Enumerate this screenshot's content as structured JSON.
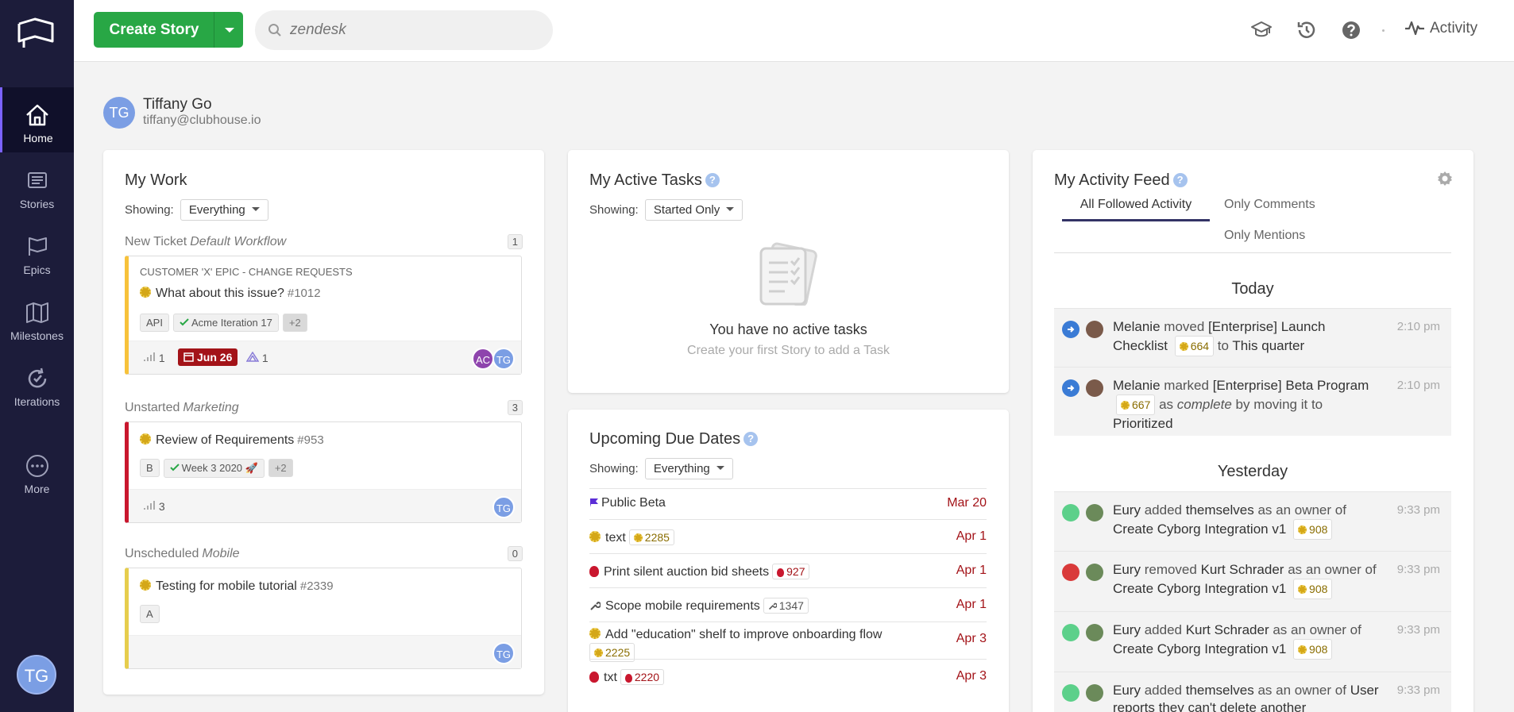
{
  "sidebar": {
    "items": [
      {
        "label": "Home"
      },
      {
        "label": "Stories"
      },
      {
        "label": "Epics"
      },
      {
        "label": "Milestones"
      },
      {
        "label": "Iterations"
      },
      {
        "label": "More"
      }
    ],
    "avatar_initials": "TG"
  },
  "topbar": {
    "create_label": "Create Story",
    "search_placeholder": "zendesk",
    "activity_label": "Activity"
  },
  "user": {
    "initials": "TG",
    "name": "Tiffany Go",
    "email": "tiffany@clubhouse.io"
  },
  "my_work": {
    "title": "My Work",
    "showing_label": "Showing:",
    "filter": "Everything",
    "groups": [
      {
        "state": "New Ticket",
        "workflow": "Default Workflow",
        "count": "1",
        "card": {
          "epic": "CUSTOMER 'X' EPIC - CHANGE REQUESTS",
          "title": "What about this issue?",
          "number": "#1012",
          "tags": [
            "API",
            "Acme Iteration 17",
            "+2"
          ],
          "estimate": "1",
          "due": "Jun 26",
          "tasks": "1",
          "owners": [
            "AC",
            "TG"
          ]
        }
      },
      {
        "state": "Unstarted",
        "workflow": "Marketing",
        "count": "3",
        "card": {
          "title": "Review of Requirements",
          "number": "#953",
          "tags": [
            "B",
            "Week 3 2020 🚀",
            "+2"
          ],
          "estimate": "3",
          "owners": [
            "TG"
          ]
        }
      },
      {
        "state": "Unscheduled",
        "workflow": "Mobile",
        "count": "0",
        "card": {
          "title": "Testing for mobile tutorial",
          "number": "#2339",
          "tags": [
            "A"
          ],
          "owners": [
            "TG"
          ]
        }
      }
    ]
  },
  "active_tasks": {
    "title": "My Active Tasks",
    "showing_label": "Showing:",
    "filter": "Started Only",
    "empty_title": "You have no active tasks",
    "empty_sub": "Create your first Story to add a Task"
  },
  "due_dates": {
    "title": "Upcoming Due Dates",
    "showing_label": "Showing:",
    "filter": "Everything",
    "rows": [
      {
        "name": "Public Beta",
        "id": "",
        "date": "Mar 20",
        "type": "milestone"
      },
      {
        "name": "text",
        "id": "2285",
        "date": "Apr 1",
        "type": "feature"
      },
      {
        "name": "Print silent auction bid sheets",
        "id": "927",
        "date": "Apr 1",
        "type": "bug"
      },
      {
        "name": "Scope mobile requirements",
        "id": "1347",
        "date": "Apr 1",
        "type": "chore"
      },
      {
        "name": "Add \"education\" shelf to improve onboarding flow",
        "id": "2225",
        "date": "Apr 3",
        "type": "feature"
      },
      {
        "name": "txt",
        "id": "2220",
        "date": "Apr 3",
        "type": "bug"
      }
    ]
  },
  "activity_feed": {
    "title": "My Activity Feed",
    "tabs": [
      "All Followed Activity",
      "Only Comments",
      "Only Mentions"
    ],
    "today_label": "Today",
    "yesterday_label": "Yesterday",
    "items": [
      {
        "who": "Melanie",
        "verb": "moved",
        "story": "[Enterprise] Launch Checklist",
        "id": "664",
        "rest_a": "to",
        "rest_b": "This quarter",
        "rest_c": "",
        "time": "2:10 pm"
      },
      {
        "who": "Melanie",
        "verb": "marked",
        "story": "[Enterprise] Beta Program",
        "id": "667",
        "rest_a": "as",
        "rest_b": "complete",
        "rest_c": "by moving it to",
        "rest_d": "Prioritized",
        "time": "2:10 pm"
      },
      {
        "who": "Eury",
        "verb": "added",
        "obj": "themselves",
        "mid": "as an owner of",
        "story": "Create Cyborg Integration v1",
        "id": "908",
        "time": "9:33 pm"
      },
      {
        "who": "Eury",
        "verb": "removed",
        "obj": "Kurt Schrader",
        "mid": "as an owner of",
        "story": "Create Cyborg Integration v1",
        "id": "908",
        "time": "9:33 pm"
      },
      {
        "who": "Eury",
        "verb": "added",
        "obj": "Kurt Schrader",
        "mid": "as an owner of",
        "story": "Create Cyborg Integration v1",
        "id": "908",
        "time": "9:33 pm"
      },
      {
        "who": "Eury",
        "verb": "added",
        "obj": "themselves",
        "mid": "as an owner of",
        "story": "User reports they can't delete another",
        "id": "",
        "time": "9:33 pm"
      }
    ]
  },
  "colors": {
    "sidebar_bg": "#1c1c3a",
    "accent_green": "#28a745",
    "due_red": "#a31318",
    "feature_gold": "#d4a718",
    "active_tab": "#333366"
  }
}
